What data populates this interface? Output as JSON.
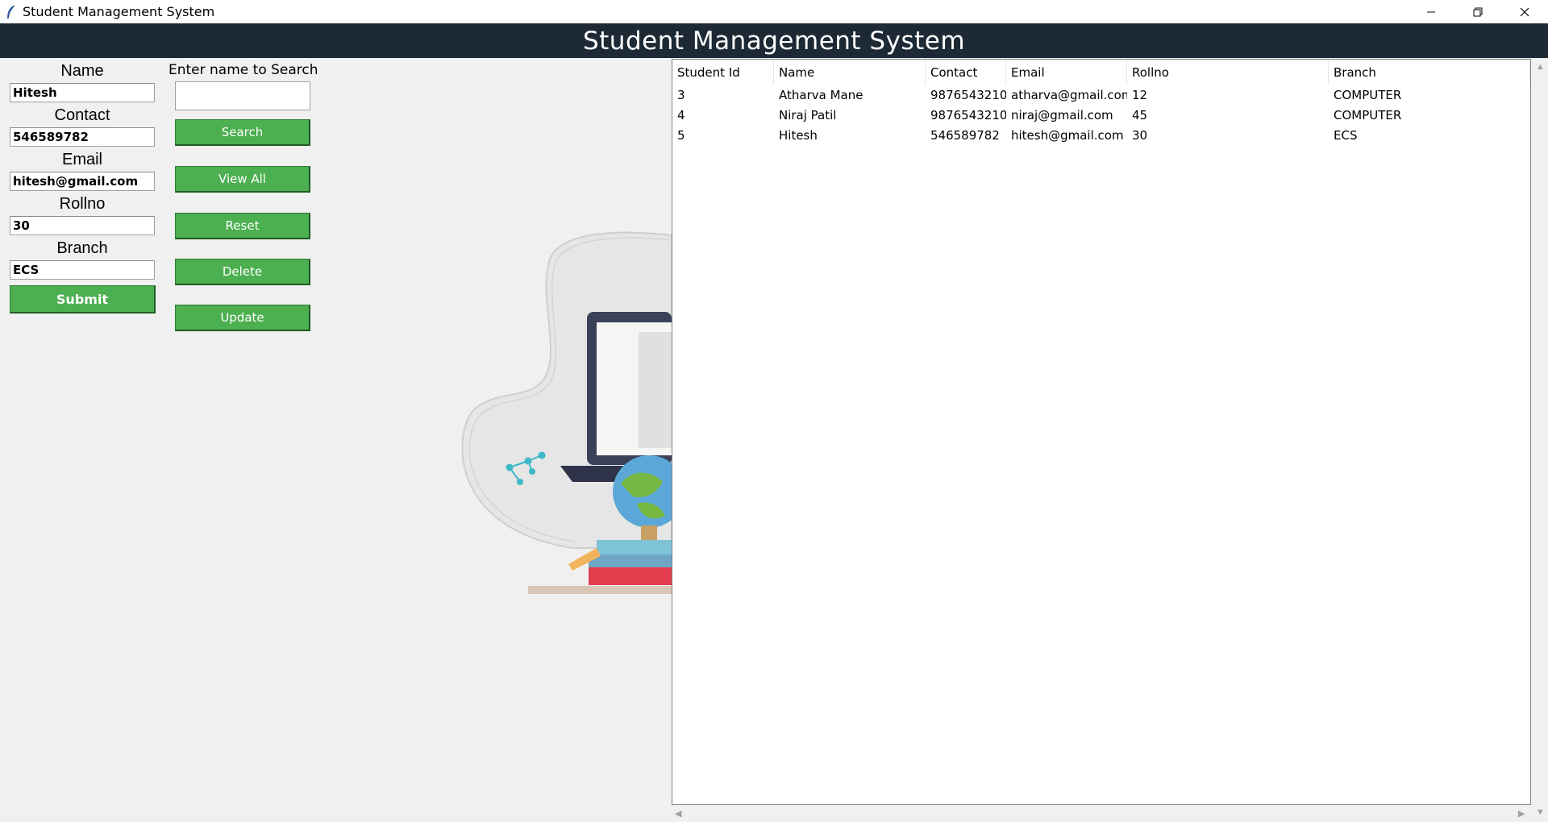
{
  "window": {
    "title": "Student Management System",
    "controls": [
      "minimize-icon",
      "restore-icon",
      "close-icon"
    ]
  },
  "header": {
    "title": "Student Management System"
  },
  "form": {
    "name_label": "Name",
    "name_value": "Hitesh",
    "contact_label": "Contact",
    "contact_value": "546589782",
    "email_label": "Email",
    "email_value": "hitesh@gmail.com",
    "rollno_label": "Rollno",
    "rollno_value": "30",
    "branch_label": "Branch",
    "branch_value": "ECS",
    "submit_label": "Submit"
  },
  "search": {
    "label": "Enter name to Search",
    "value": "",
    "search_label": "Search",
    "view_all_label": "View All",
    "reset_label": "Reset",
    "delete_label": "Delete",
    "update_label": "Update"
  },
  "colors": {
    "header_bg": "#1d2a35",
    "button_green": "#4caf50"
  },
  "table": {
    "columns": [
      "Student Id",
      "Name",
      "Contact",
      "Email",
      "Rollno",
      "Branch"
    ],
    "rows": [
      [
        "3",
        "Atharva Mane",
        "9876543210",
        "atharva@gmail.com",
        "12",
        "COMPUTER"
      ],
      [
        "4",
        "Niraj Patil",
        "9876543210",
        "niraj@gmail.com",
        "45",
        "COMPUTER"
      ],
      [
        "5",
        "Hitesh",
        "546589782",
        "hitesh@gmail.com",
        "30",
        "ECS"
      ]
    ]
  }
}
